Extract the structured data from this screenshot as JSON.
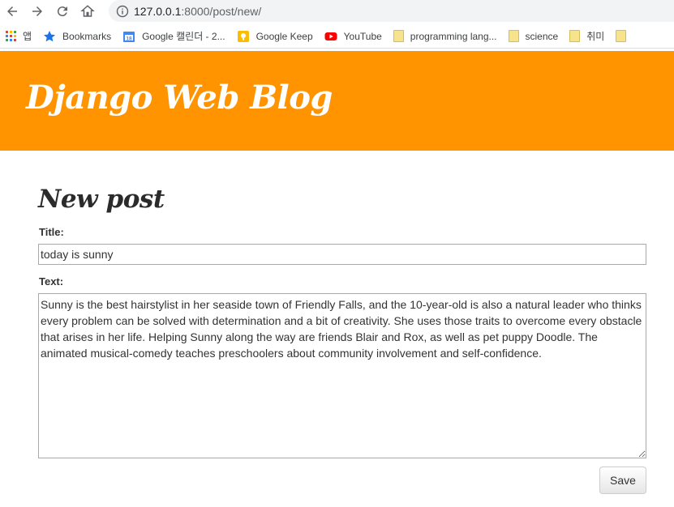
{
  "browser": {
    "url_host": "127.0.0.1",
    "url_rest": ":8000/post/new/",
    "bookmarks": [
      {
        "label": "앱",
        "icon": "apps-grid-icon"
      },
      {
        "label": "Bookmarks",
        "icon": "star-icon"
      },
      {
        "label": "Google 캘린더 - 2...",
        "icon": "calendar-icon"
      },
      {
        "label": "Google Keep",
        "icon": "keep-bulb-icon"
      },
      {
        "label": "YouTube",
        "icon": "youtube-icon"
      },
      {
        "label": "programming lang...",
        "icon": "folder-icon"
      },
      {
        "label": "science",
        "icon": "folder-icon"
      },
      {
        "label": "취미",
        "icon": "folder-icon"
      }
    ]
  },
  "header": {
    "site_title": "Django Web Blog",
    "color": "#ff9400"
  },
  "form": {
    "heading": "New post",
    "title_label": "Title:",
    "title_value": "today is sunny",
    "text_label": "Text:",
    "text_value": "Sunny is the best hairstylist in her seaside town of Friendly Falls, and the 10-year-old is also a natural leader who thinks every problem can be solved with determination and a bit of creativity. She uses those traits to overcome every obstacle that arises in her life. Helping Sunny along the way are friends Blair and Rox, as well as pet puppy Doodle. The animated musical-comedy teaches preschoolers about community involvement and self-confidence.",
    "save_label": "Save"
  }
}
